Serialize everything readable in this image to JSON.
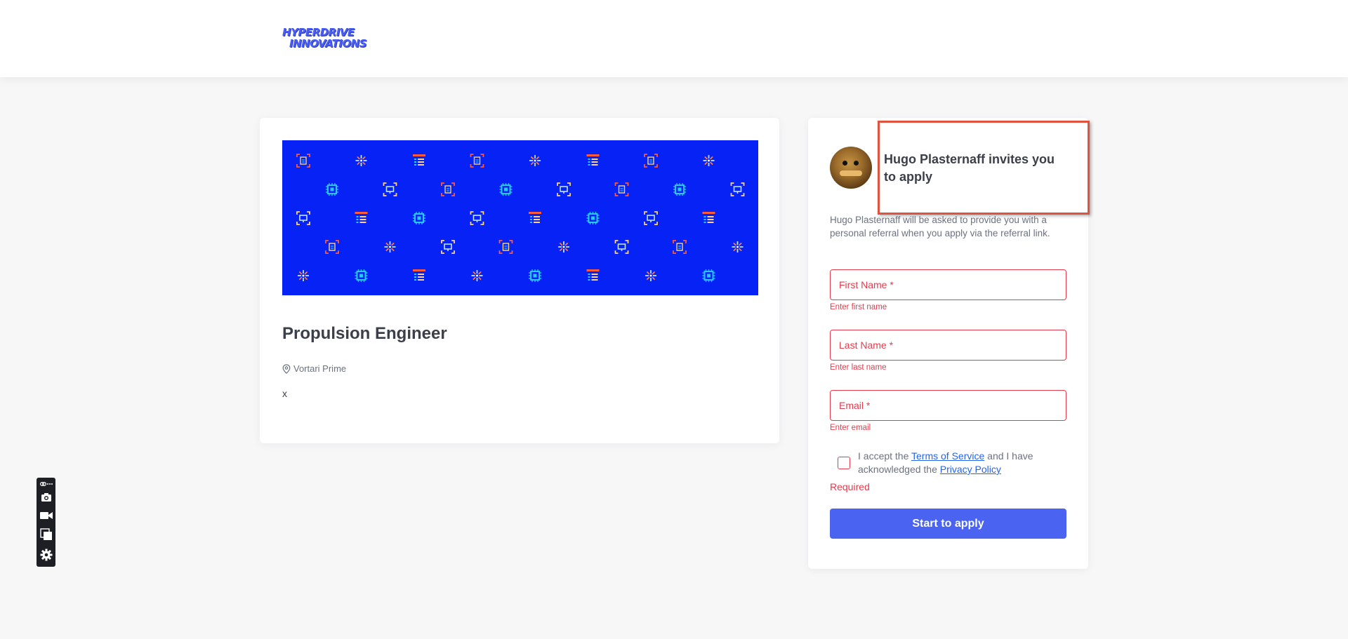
{
  "brand": {
    "line1": "HYPERDRIVE",
    "line2": "INNOVATIONS"
  },
  "job": {
    "title": "Propulsion Engineer",
    "location": "Vortari Prime",
    "description": "x"
  },
  "invite": {
    "title": "Hugo Plasternaff invites you to apply",
    "note": "Hugo Plasternaff will be asked to provide you with a personal referral when you apply via the referral link."
  },
  "form": {
    "first_name": {
      "placeholder": "First Name *",
      "value": "",
      "error": "Enter first name"
    },
    "last_name": {
      "placeholder": "Last Name *",
      "value": "",
      "error": "Enter last name"
    },
    "email": {
      "placeholder": "Email *",
      "value": "",
      "error": "Enter email"
    },
    "terms": {
      "prefix": "I accept the ",
      "tos_link": "Terms of Service",
      "middle": " and I have acknowledged the ",
      "privacy_link": "Privacy Policy",
      "checked": false,
      "error": "Required"
    },
    "submit_label": "Start to apply"
  },
  "colors": {
    "brand_blue": "#4a5ef0",
    "banner_bg": "#0622f5",
    "error_red": "#e53b4c",
    "button_blue": "#4a63f0",
    "link_blue": "#2563eb",
    "highlight_red": "#e0533f"
  },
  "toolbar_icons": [
    "link-icon",
    "camera-icon",
    "video-icon",
    "windows-icon",
    "gear-icon"
  ]
}
